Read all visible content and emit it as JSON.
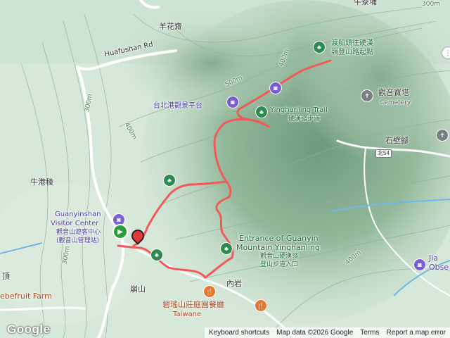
{
  "map": {
    "road_name": "Huafushan Rd",
    "route_shield": "北54",
    "places": [
      {
        "id": "top-right-village",
        "text": "牛寮埔"
      },
      {
        "id": "yanghuazhai",
        "text": "羊花齋"
      },
      {
        "id": "niugangleng",
        "text": "牛港稜"
      },
      {
        "id": "shibijiao",
        "text": "石壁腳"
      },
      {
        "id": "bengshan",
        "text": "崩山"
      },
      {
        "id": "neiyan",
        "text": "內岩"
      },
      {
        "id": "ding",
        "text": "頂"
      }
    ],
    "pois": [
      {
        "id": "trailhead-ferry",
        "line1": "渡船頭往硬漢",
        "line2": "嶺登山路起點",
        "icon": "park-icon"
      },
      {
        "id": "taipei-port-view",
        "text": "台北港觀景平台",
        "icon": "camera-icon"
      },
      {
        "id": "yinghanling-trail",
        "line1": "Yinghanling Trail",
        "line2": "硬漢嶺步道",
        "icon": "park-icon"
      },
      {
        "id": "guanyin-tower",
        "line1": "觀音寶塔",
        "line2": "Cemetery",
        "icon": "cemetery-icon"
      },
      {
        "id": "visitor-center",
        "line1": "Guanyinshan",
        "line2": "Visitor Center",
        "line3": "觀音山遊客中心",
        "line4": "(觀音山管理站)",
        "icon": "camera-icon"
      },
      {
        "id": "entrance-guanyin",
        "line1": "Entrance of Guanyin",
        "line2": "Mountain Yinghanling",
        "line3": "觀音山硬漢嶺",
        "line4": "登山步道入口",
        "icon": "park-icon"
      },
      {
        "id": "biyao-restaurant",
        "text": "碧瑤山莊庭園餐廳",
        "icon": "food-icon"
      },
      {
        "id": "jia-obs",
        "line1": "Jia",
        "line2": "Obse",
        "icon": "camera-icon"
      },
      {
        "id": "bottom-left-farm",
        "line1": "ebefruit Farm",
        "line2": "Taiwane",
        "icon": "none"
      }
    ],
    "contour_labels": [
      "300m",
      "400m",
      "500m",
      "400m",
      "300m",
      "400m",
      "300m"
    ],
    "route_color": "#f25a5a",
    "water_color": "#6fb8e8"
  },
  "attribution": {
    "logo": "Google",
    "shortcuts": "Keyboard shortcuts",
    "data": "Map data ©2026 Google",
    "terms": "Terms",
    "report": "Report a map error"
  }
}
